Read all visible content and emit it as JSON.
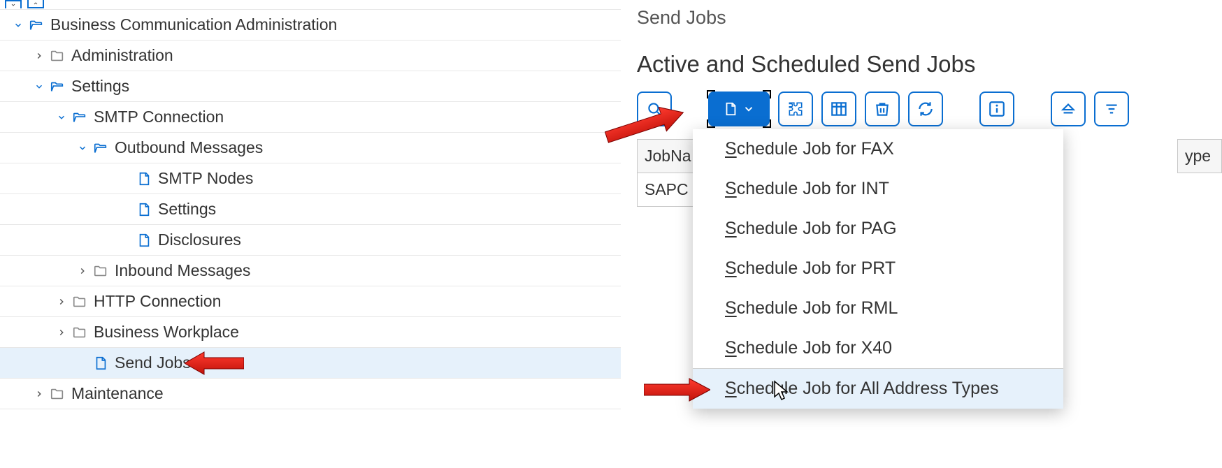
{
  "breadcrumb": "Send Jobs",
  "subtitle": "Active and Scheduled Send Jobs",
  "table": {
    "col1_header": "JobNa",
    "col2_header": "ype",
    "row1_col1": "SAPC"
  },
  "tree": [
    {
      "label": "Business Communication Administration",
      "exp": "down",
      "icon": "folder-open",
      "indent": 16
    },
    {
      "label": "Administration",
      "exp": "right",
      "icon": "folder",
      "indent": 46
    },
    {
      "label": "Settings",
      "exp": "down",
      "icon": "folder-open",
      "indent": 46
    },
    {
      "label": "SMTP Connection",
      "exp": "down",
      "icon": "folder-open",
      "indent": 78
    },
    {
      "label": "Outbound Messages",
      "exp": "down",
      "icon": "folder-open",
      "indent": 108
    },
    {
      "label": "SMTP Nodes",
      "exp": "none",
      "icon": "doc",
      "indent": 170
    },
    {
      "label": "Settings",
      "exp": "none",
      "icon": "doc",
      "indent": 170
    },
    {
      "label": "Disclosures",
      "exp": "none",
      "icon": "doc",
      "indent": 170
    },
    {
      "label": "Inbound Messages",
      "exp": "right",
      "icon": "folder",
      "indent": 108
    },
    {
      "label": "HTTP Connection",
      "exp": "right",
      "icon": "folder",
      "indent": 78
    },
    {
      "label": "Business Workplace",
      "exp": "right",
      "icon": "folder",
      "indent": 78
    },
    {
      "label": "Send Jobs",
      "exp": "none",
      "icon": "doc",
      "indent": 108,
      "selected": true
    },
    {
      "label": "Maintenance",
      "exp": "right",
      "icon": "folder",
      "indent": 46
    }
  ],
  "menu": [
    "Schedule Job for FAX",
    "Schedule Job for INT",
    "Schedule Job for PAG",
    "Schedule Job for PRT",
    "Schedule Job for RML",
    "Schedule Job for X40",
    "Schedule Job for All Address Types"
  ]
}
